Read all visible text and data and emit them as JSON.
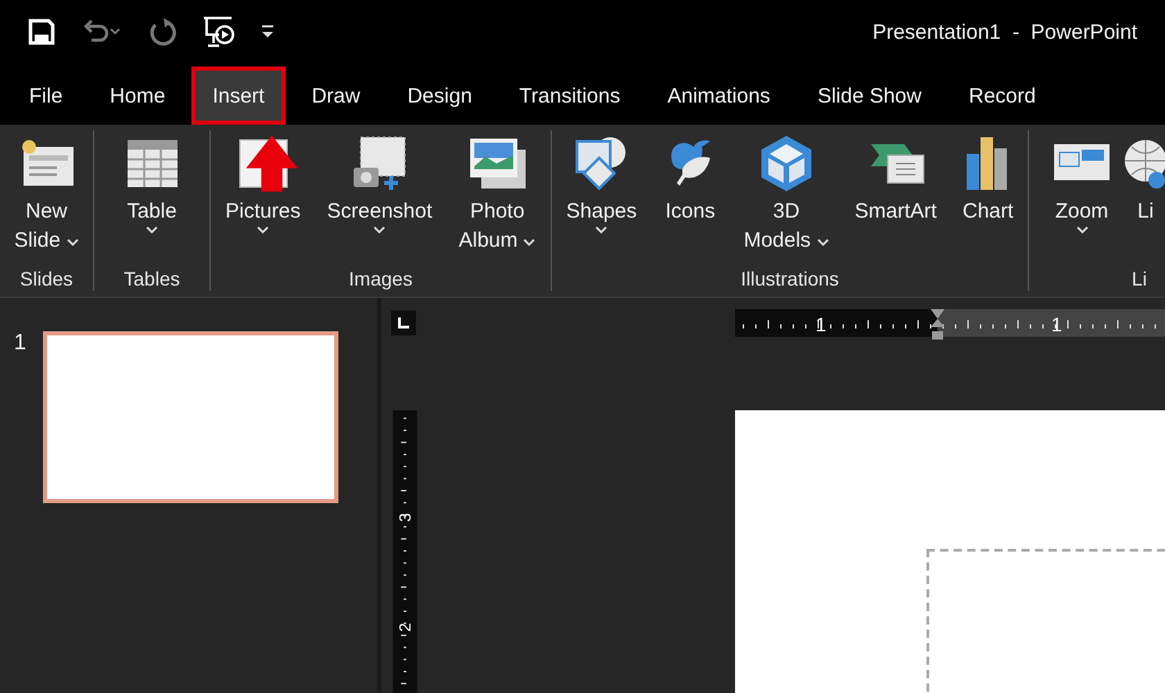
{
  "title_bar": {
    "document_title": "Presentation1  -  PowerPoint"
  },
  "tabs": [
    {
      "label": "File",
      "selected": false,
      "highlighted": false
    },
    {
      "label": "Home",
      "selected": false,
      "highlighted": false
    },
    {
      "label": "Insert",
      "selected": true,
      "highlighted": true
    },
    {
      "label": "Draw",
      "selected": false,
      "highlighted": false
    },
    {
      "label": "Design",
      "selected": false,
      "highlighted": false
    },
    {
      "label": "Transitions",
      "selected": false,
      "highlighted": false
    },
    {
      "label": "Animations",
      "selected": false,
      "highlighted": false
    },
    {
      "label": "Slide Show",
      "selected": false,
      "highlighted": false
    },
    {
      "label": "Record",
      "selected": false,
      "highlighted": false
    }
  ],
  "ribbon": {
    "groups": [
      {
        "label": "Slides",
        "buttons": [
          {
            "label": "New\nSlide",
            "dropdown": true
          }
        ]
      },
      {
        "label": "Tables",
        "buttons": [
          {
            "label": "Table",
            "dropdown": true
          }
        ]
      },
      {
        "label": "Images",
        "buttons": [
          {
            "label": "Pictures",
            "dropdown": true
          },
          {
            "label": "Screenshot",
            "dropdown": true
          },
          {
            "label": "Photo\nAlbum",
            "dropdown": true
          }
        ]
      },
      {
        "label": "Illustrations",
        "buttons": [
          {
            "label": "Shapes",
            "dropdown": true
          },
          {
            "label": "Icons",
            "dropdown": false
          },
          {
            "label": "3D\nModels",
            "dropdown": true
          },
          {
            "label": "SmartArt",
            "dropdown": false
          },
          {
            "label": "Chart",
            "dropdown": false
          }
        ]
      },
      {
        "label": "Li",
        "buttons": [
          {
            "label": "Zoom",
            "dropdown": true
          },
          {
            "label": "Li",
            "dropdown": false
          }
        ]
      }
    ]
  },
  "slides": [
    {
      "number": "1",
      "selected": true
    }
  ],
  "horizontal_ruler": {
    "numbers": [
      "1",
      "1"
    ]
  },
  "vertical_ruler": {
    "numbers": [
      "3",
      "2"
    ]
  }
}
